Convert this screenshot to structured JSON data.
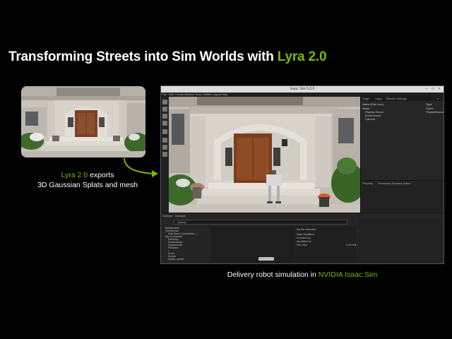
{
  "slide": {
    "title_main": "Transforming Streets into Sim Worlds with ",
    "title_accent": "Lyra 2.0",
    "caption_left_accent": "Lyra 2.0",
    "caption_left_text": " exports",
    "caption_left_line2": "3D Gaussian Splats and mesh",
    "caption_bottom_text": "Delivery robot simulation in ",
    "caption_bottom_accent": "NVIDIA Isaac Sim"
  },
  "colors": {
    "accent": "#76b900",
    "background": "#000000"
  },
  "app": {
    "window_title": "Isaac Sim 5.0.0",
    "menu": [
      "File",
      "Edit",
      "Create",
      "Window",
      "Tools",
      "Utilities",
      "Layout",
      "Help"
    ],
    "panel_tabs": [
      "Stage",
      "Layer",
      "Render Settings"
    ],
    "stage_header": [
      "Name (Eye Icon)",
      "Type"
    ],
    "stage_items": [
      "World",
      "Physics Scene",
      "Environment",
      "Camera"
    ],
    "stage_item_types": [
      "Xform",
      "PhysicsScene",
      "",
      ""
    ],
    "lower_tabs": [
      "Property",
      "Semantics Schema Editor"
    ],
    "bottom_tabs": [
      "Content",
      "Console"
    ],
    "search_placeholder": "Search",
    "file_tree": [
      "Bookmarks",
      "Omniverse",
      "Add New Connection ...",
      "My Computer",
      "Desktop",
      "Documents",
      "Downloads",
      "Pictures",
      "/",
      "/boot",
      "/home",
      "/isaac_asset"
    ],
    "props_header": "No file selected",
    "props": [
      "Date Modified",
      "Created by",
      "Modified by",
      "File size"
    ],
    "props_values": [
      "",
      "",
      "",
      "0.00 KB"
    ]
  }
}
